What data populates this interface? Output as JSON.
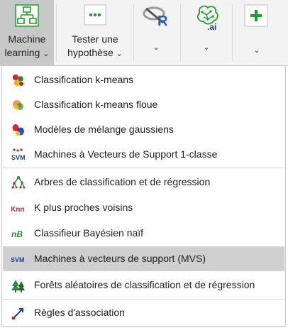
{
  "ribbon": {
    "ml": {
      "line1": "Machine",
      "line2": "learning",
      "chevron": "⌄"
    },
    "tester": {
      "line1": "Tester une",
      "line2": "hypothèse",
      "chevron": "⌄"
    },
    "r_chevron": "⌄",
    "ai_chevron": "⌄",
    "plus_chevron": "⌄",
    "ai_badge": ".ai",
    "r_letter": "R",
    "dots": "•••"
  },
  "menu": {
    "items": [
      {
        "label": "Classification k-means",
        "icon": "kmeans-icon"
      },
      {
        "label": "Classification k-means floue",
        "icon": "fuzzy-kmeans-icon"
      },
      {
        "label": "Modèles de mélange gaussiens",
        "icon": "gaussian-mixture-icon"
      },
      {
        "label": "Machines à Vecteurs de Support 1-classe",
        "icon": "svm-one-class-icon",
        "icon_text": "SVM"
      },
      {
        "label": "Arbres de classification et de régression",
        "icon": "decision-tree-icon"
      },
      {
        "label": "K plus proches voisins",
        "icon": "knn-icon",
        "icon_text": "Knn"
      },
      {
        "label": "Classifieur Bayésien naïf",
        "icon": "naive-bayes-icon",
        "icon_text": "nB"
      },
      {
        "label": "Machines à vecteurs de support (MVS)",
        "icon": "svm-icon",
        "icon_text": "SVM",
        "highlighted": true
      },
      {
        "label": "Forêts aléatoires de classification et de régression",
        "icon": "random-forest-icon"
      },
      {
        "label": "Règles d'association",
        "icon": "association-rules-icon"
      }
    ]
  },
  "colors": {
    "active_bg": "#c8c8c8",
    "highlight_bg": "#cfcfcf",
    "green": "#1e9e2c",
    "svm_blue": "#1f3f8f",
    "knn_red": "#c0282d"
  }
}
